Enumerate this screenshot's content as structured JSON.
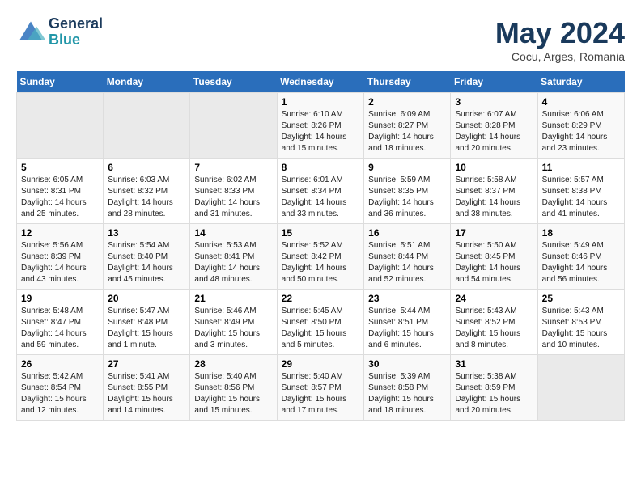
{
  "header": {
    "logo_line1": "General",
    "logo_line2": "Blue",
    "month_year": "May 2024",
    "location": "Cocu, Arges, Romania"
  },
  "days_of_week": [
    "Sunday",
    "Monday",
    "Tuesday",
    "Wednesday",
    "Thursday",
    "Friday",
    "Saturday"
  ],
  "weeks": [
    [
      {
        "num": "",
        "info": "",
        "empty": true
      },
      {
        "num": "",
        "info": "",
        "empty": true
      },
      {
        "num": "",
        "info": "",
        "empty": true
      },
      {
        "num": "1",
        "info": "Sunrise: 6:10 AM\nSunset: 8:26 PM\nDaylight: 14 hours\nand 15 minutes.",
        "empty": false
      },
      {
        "num": "2",
        "info": "Sunrise: 6:09 AM\nSunset: 8:27 PM\nDaylight: 14 hours\nand 18 minutes.",
        "empty": false
      },
      {
        "num": "3",
        "info": "Sunrise: 6:07 AM\nSunset: 8:28 PM\nDaylight: 14 hours\nand 20 minutes.",
        "empty": false
      },
      {
        "num": "4",
        "info": "Sunrise: 6:06 AM\nSunset: 8:29 PM\nDaylight: 14 hours\nand 23 minutes.",
        "empty": false
      }
    ],
    [
      {
        "num": "5",
        "info": "Sunrise: 6:05 AM\nSunset: 8:31 PM\nDaylight: 14 hours\nand 25 minutes.",
        "empty": false
      },
      {
        "num": "6",
        "info": "Sunrise: 6:03 AM\nSunset: 8:32 PM\nDaylight: 14 hours\nand 28 minutes.",
        "empty": false
      },
      {
        "num": "7",
        "info": "Sunrise: 6:02 AM\nSunset: 8:33 PM\nDaylight: 14 hours\nand 31 minutes.",
        "empty": false
      },
      {
        "num": "8",
        "info": "Sunrise: 6:01 AM\nSunset: 8:34 PM\nDaylight: 14 hours\nand 33 minutes.",
        "empty": false
      },
      {
        "num": "9",
        "info": "Sunrise: 5:59 AM\nSunset: 8:35 PM\nDaylight: 14 hours\nand 36 minutes.",
        "empty": false
      },
      {
        "num": "10",
        "info": "Sunrise: 5:58 AM\nSunset: 8:37 PM\nDaylight: 14 hours\nand 38 minutes.",
        "empty": false
      },
      {
        "num": "11",
        "info": "Sunrise: 5:57 AM\nSunset: 8:38 PM\nDaylight: 14 hours\nand 41 minutes.",
        "empty": false
      }
    ],
    [
      {
        "num": "12",
        "info": "Sunrise: 5:56 AM\nSunset: 8:39 PM\nDaylight: 14 hours\nand 43 minutes.",
        "empty": false
      },
      {
        "num": "13",
        "info": "Sunrise: 5:54 AM\nSunset: 8:40 PM\nDaylight: 14 hours\nand 45 minutes.",
        "empty": false
      },
      {
        "num": "14",
        "info": "Sunrise: 5:53 AM\nSunset: 8:41 PM\nDaylight: 14 hours\nand 48 minutes.",
        "empty": false
      },
      {
        "num": "15",
        "info": "Sunrise: 5:52 AM\nSunset: 8:42 PM\nDaylight: 14 hours\nand 50 minutes.",
        "empty": false
      },
      {
        "num": "16",
        "info": "Sunrise: 5:51 AM\nSunset: 8:44 PM\nDaylight: 14 hours\nand 52 minutes.",
        "empty": false
      },
      {
        "num": "17",
        "info": "Sunrise: 5:50 AM\nSunset: 8:45 PM\nDaylight: 14 hours\nand 54 minutes.",
        "empty": false
      },
      {
        "num": "18",
        "info": "Sunrise: 5:49 AM\nSunset: 8:46 PM\nDaylight: 14 hours\nand 56 minutes.",
        "empty": false
      }
    ],
    [
      {
        "num": "19",
        "info": "Sunrise: 5:48 AM\nSunset: 8:47 PM\nDaylight: 14 hours\nand 59 minutes.",
        "empty": false
      },
      {
        "num": "20",
        "info": "Sunrise: 5:47 AM\nSunset: 8:48 PM\nDaylight: 15 hours\nand 1 minute.",
        "empty": false
      },
      {
        "num": "21",
        "info": "Sunrise: 5:46 AM\nSunset: 8:49 PM\nDaylight: 15 hours\nand 3 minutes.",
        "empty": false
      },
      {
        "num": "22",
        "info": "Sunrise: 5:45 AM\nSunset: 8:50 PM\nDaylight: 15 hours\nand 5 minutes.",
        "empty": false
      },
      {
        "num": "23",
        "info": "Sunrise: 5:44 AM\nSunset: 8:51 PM\nDaylight: 15 hours\nand 6 minutes.",
        "empty": false
      },
      {
        "num": "24",
        "info": "Sunrise: 5:43 AM\nSunset: 8:52 PM\nDaylight: 15 hours\nand 8 minutes.",
        "empty": false
      },
      {
        "num": "25",
        "info": "Sunrise: 5:43 AM\nSunset: 8:53 PM\nDaylight: 15 hours\nand 10 minutes.",
        "empty": false
      }
    ],
    [
      {
        "num": "26",
        "info": "Sunrise: 5:42 AM\nSunset: 8:54 PM\nDaylight: 15 hours\nand 12 minutes.",
        "empty": false
      },
      {
        "num": "27",
        "info": "Sunrise: 5:41 AM\nSunset: 8:55 PM\nDaylight: 15 hours\nand 14 minutes.",
        "empty": false
      },
      {
        "num": "28",
        "info": "Sunrise: 5:40 AM\nSunset: 8:56 PM\nDaylight: 15 hours\nand 15 minutes.",
        "empty": false
      },
      {
        "num": "29",
        "info": "Sunrise: 5:40 AM\nSunset: 8:57 PM\nDaylight: 15 hours\nand 17 minutes.",
        "empty": false
      },
      {
        "num": "30",
        "info": "Sunrise: 5:39 AM\nSunset: 8:58 PM\nDaylight: 15 hours\nand 18 minutes.",
        "empty": false
      },
      {
        "num": "31",
        "info": "Sunrise: 5:38 AM\nSunset: 8:59 PM\nDaylight: 15 hours\nand 20 minutes.",
        "empty": false
      },
      {
        "num": "",
        "info": "",
        "empty": true
      }
    ]
  ]
}
